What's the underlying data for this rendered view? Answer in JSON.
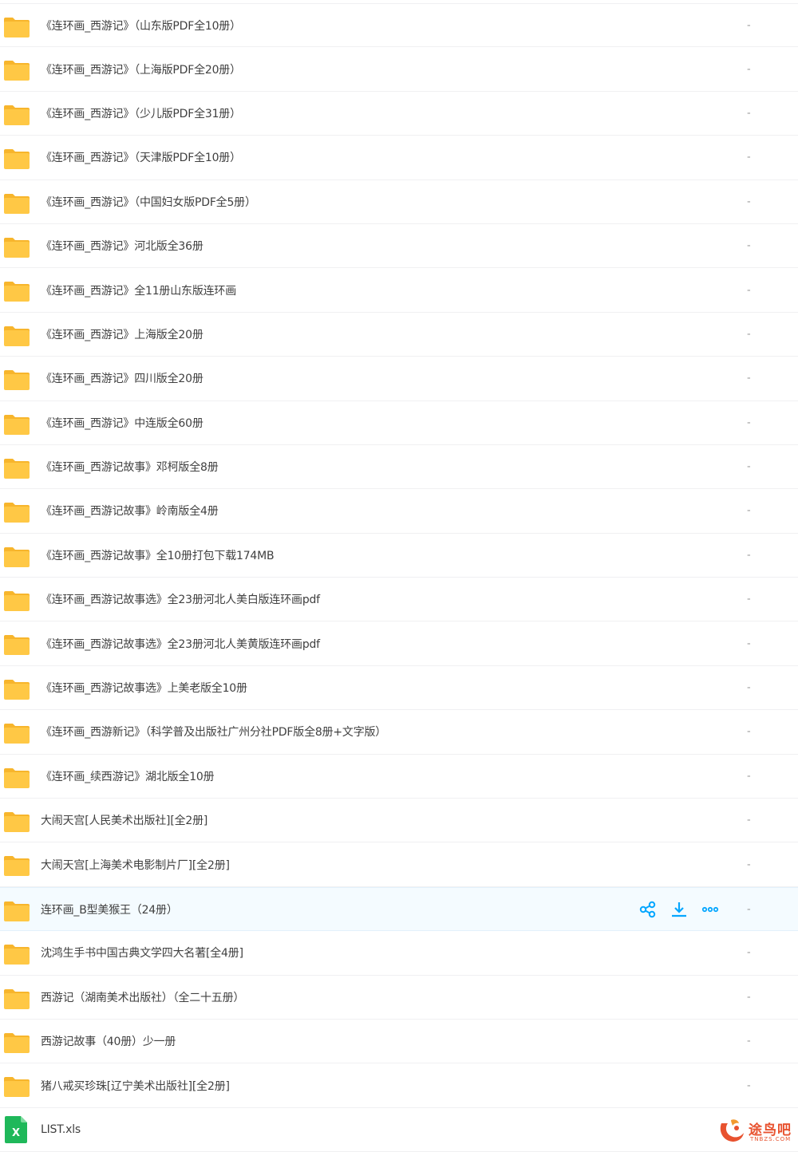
{
  "colors": {
    "folder": "#ffc845",
    "folder_tab": "#f7b52c",
    "accent": "#06a7ff",
    "xls": "#1fb85a",
    "watermark": "#e8522f"
  },
  "rows": [
    {
      "name": "《连环画_西游记》（山东版PDF全10册）",
      "size": "-",
      "icon": "folder-icon"
    },
    {
      "name": "《连环画_西游记》（上海版PDF全20册）",
      "size": "-",
      "icon": "folder-icon"
    },
    {
      "name": "《连环画_西游记》（少儿版PDF全31册）",
      "size": "-",
      "icon": "folder-icon"
    },
    {
      "name": "《连环画_西游记》（天津版PDF全10册）",
      "size": "-",
      "icon": "folder-icon"
    },
    {
      "name": "《连环画_西游记》（中国妇女版PDF全5册）",
      "size": "-",
      "icon": "folder-icon"
    },
    {
      "name": "《连环画_西游记》河北版全36册",
      "size": "-",
      "icon": "folder-icon"
    },
    {
      "name": "《连环画_西游记》全11册山东版连环画",
      "size": "-",
      "icon": "folder-icon"
    },
    {
      "name": "《连环画_西游记》上海版全20册",
      "size": "-",
      "icon": "folder-icon"
    },
    {
      "name": "《连环画_西游记》四川版全20册",
      "size": "-",
      "icon": "folder-icon"
    },
    {
      "name": "《连环画_西游记》中连版全60册",
      "size": "-",
      "icon": "folder-icon"
    },
    {
      "name": "《连环画_西游记故事》邓柯版全8册",
      "size": "-",
      "icon": "folder-icon"
    },
    {
      "name": "《连环画_西游记故事》岭南版全4册",
      "size": "-",
      "icon": "folder-icon"
    },
    {
      "name": "《连环画_西游记故事》全10册打包下载174MB",
      "size": "-",
      "icon": "folder-icon"
    },
    {
      "name": "《连环画_西游记故事选》全23册河北人美白版连环画pdf",
      "size": "-",
      "icon": "folder-icon"
    },
    {
      "name": "《连环画_西游记故事选》全23册河北人美黄版连环画pdf",
      "size": "-",
      "icon": "folder-icon"
    },
    {
      "name": "《连环画_西游记故事选》上美老版全10册",
      "size": "-",
      "icon": "folder-icon"
    },
    {
      "name": "《连环画_西游新记》（科学普及出版社广州分社PDF版全8册+文字版）",
      "size": "-",
      "icon": "folder-icon"
    },
    {
      "name": "《连环画_续西游记》湖北版全10册",
      "size": "-",
      "icon": "folder-icon"
    },
    {
      "name": "大闹天宫[人民美术出版社][全2册]",
      "size": "-",
      "icon": "folder-icon"
    },
    {
      "name": "大闹天宫[上海美术电影制片厂][全2册]",
      "size": "-",
      "icon": "folder-icon"
    },
    {
      "name": "连环画_B型美猴王（24册）",
      "size": "-",
      "icon": "folder-icon",
      "hover": true
    },
    {
      "name": "沈鸿生手书中国古典文学四大名著[全4册]",
      "size": "-",
      "icon": "folder-icon"
    },
    {
      "name": "西游记（湖南美术出版社）（全二十五册）",
      "size": "-",
      "icon": "folder-icon"
    },
    {
      "name": "西游记故事（40册）少一册",
      "size": "-",
      "icon": "folder-icon"
    },
    {
      "name": "猪八戒买珍珠[辽宁美术出版社][全2册]",
      "size": "-",
      "icon": "folder-icon"
    },
    {
      "name": "LIST.xls",
      "size": "",
      "icon": "xls-file-icon"
    }
  ],
  "hover_actions": [
    "share-icon",
    "download-icon",
    "more-icon"
  ],
  "watermark": {
    "text": "途鸟吧",
    "sub": "TNBZS.COM"
  }
}
